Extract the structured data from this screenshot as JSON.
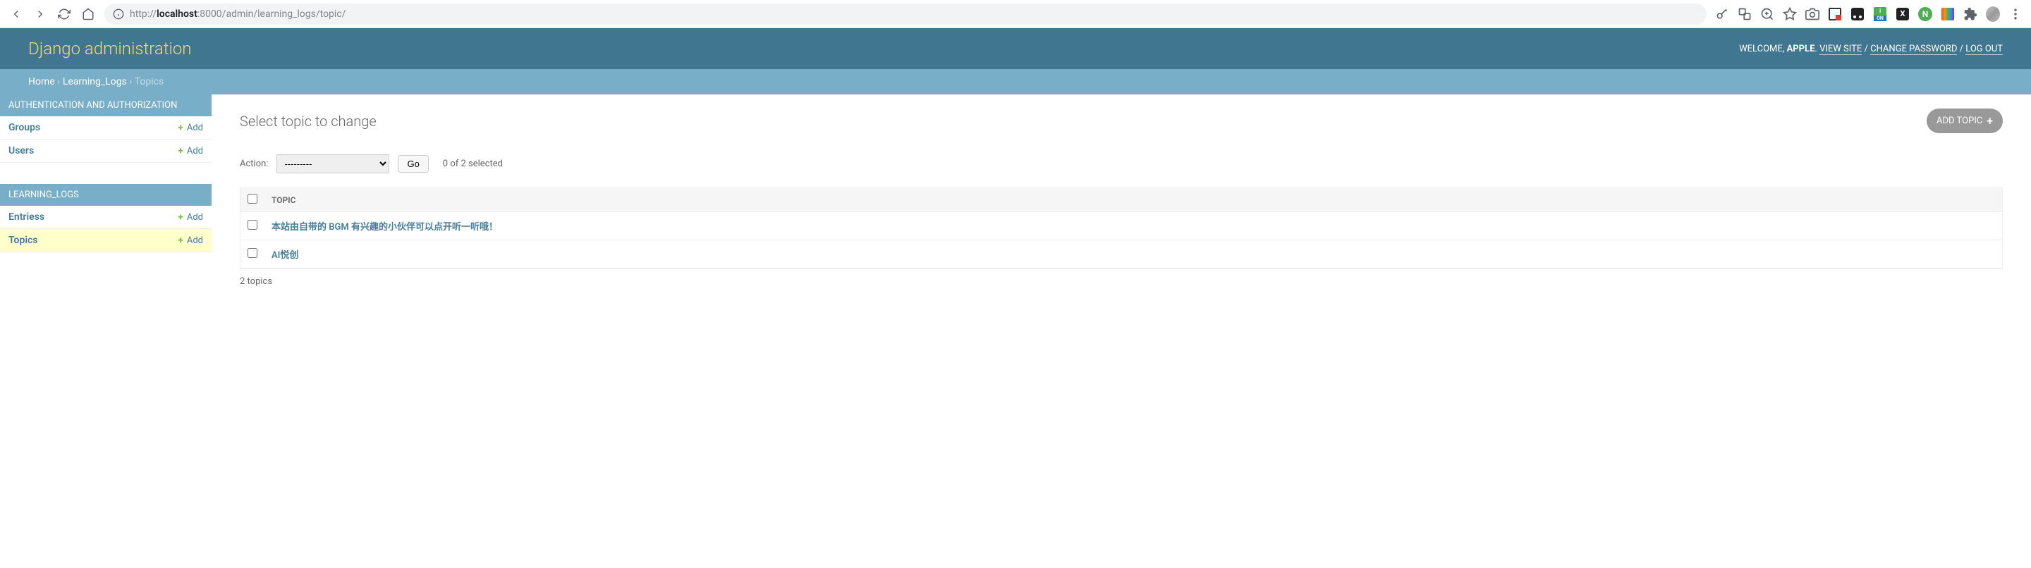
{
  "browser": {
    "url_scheme": "http://",
    "url_host": "localhost",
    "url_port_path": ":8000/admin/learning_logs/topic/"
  },
  "header": {
    "branding": "Django administration",
    "welcome": "WELCOME, ",
    "user": "APPLE",
    "view_site": "VIEW SITE",
    "change_password": "CHANGE PASSWORD",
    "log_out": "LOG OUT"
  },
  "breadcrumbs": {
    "home": "Home",
    "app": "Learning_Logs",
    "current": "Topics"
  },
  "sidebar": {
    "modules": [
      {
        "title": "AUTHENTICATION AND AUTHORIZATION",
        "items": [
          {
            "name": "Groups",
            "add": "Add"
          },
          {
            "name": "Users",
            "add": "Add"
          }
        ]
      },
      {
        "title": "LEARNING_LOGS",
        "items": [
          {
            "name": "Entriess",
            "add": "Add"
          },
          {
            "name": "Topics",
            "add": "Add",
            "selected": true
          }
        ]
      }
    ]
  },
  "content": {
    "title": "Select topic to change",
    "add_button": "ADD TOPIC",
    "actions": {
      "label": "Action:",
      "placeholder": "---------",
      "go": "Go",
      "selection": "0 of 2 selected"
    },
    "table": {
      "header": "TOPIC",
      "rows": [
        "本站由自带的 BGM 有兴趣的小伙伴可以点开听一听哦！",
        "AI悦创"
      ]
    },
    "count": "2 topics"
  }
}
